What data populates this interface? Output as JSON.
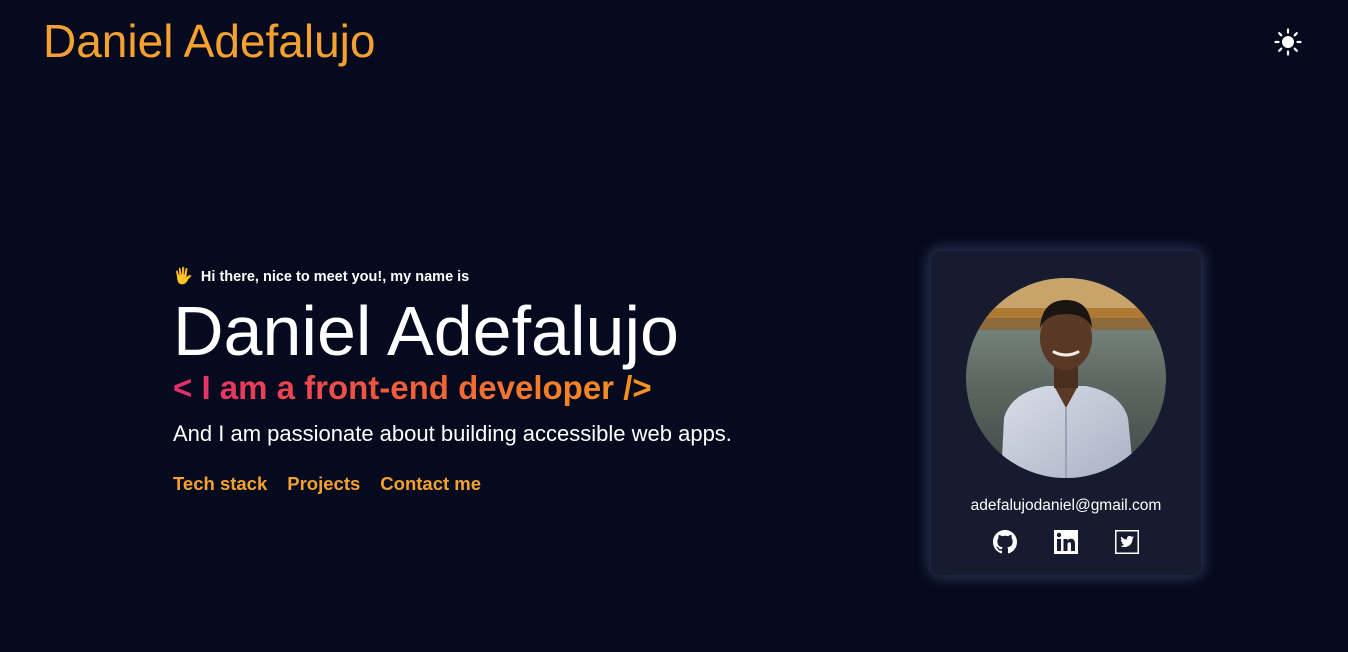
{
  "header": {
    "logo_text": "Daniel Adefalujo",
    "theme_toggle_icon": "sun-icon"
  },
  "hero": {
    "greeting_icon": "waving-hand-icon",
    "greeting_emoji": "🖐",
    "greeting": "Hi there, nice to meet you!, my name is",
    "name": "Daniel Adefalujo",
    "role": "< I am a front-end developer />",
    "tagline": "And I am passionate about building accessible web apps.",
    "links": [
      {
        "label": "Tech stack"
      },
      {
        "label": "Projects"
      },
      {
        "label": "Contact me"
      }
    ]
  },
  "profile_card": {
    "avatar_icon": "profile-photo",
    "email": "adefalujodaniel@gmail.com",
    "socials": [
      {
        "icon": "github-icon"
      },
      {
        "icon": "linkedin-icon"
      },
      {
        "icon": "twitter-icon"
      }
    ]
  },
  "colors": {
    "background": "#060a1e",
    "accent": "#f5a130",
    "card_background": "#171b2f",
    "gradient_start": "#e62c6c",
    "gradient_end": "#f7941e",
    "text": "#ffffff"
  }
}
